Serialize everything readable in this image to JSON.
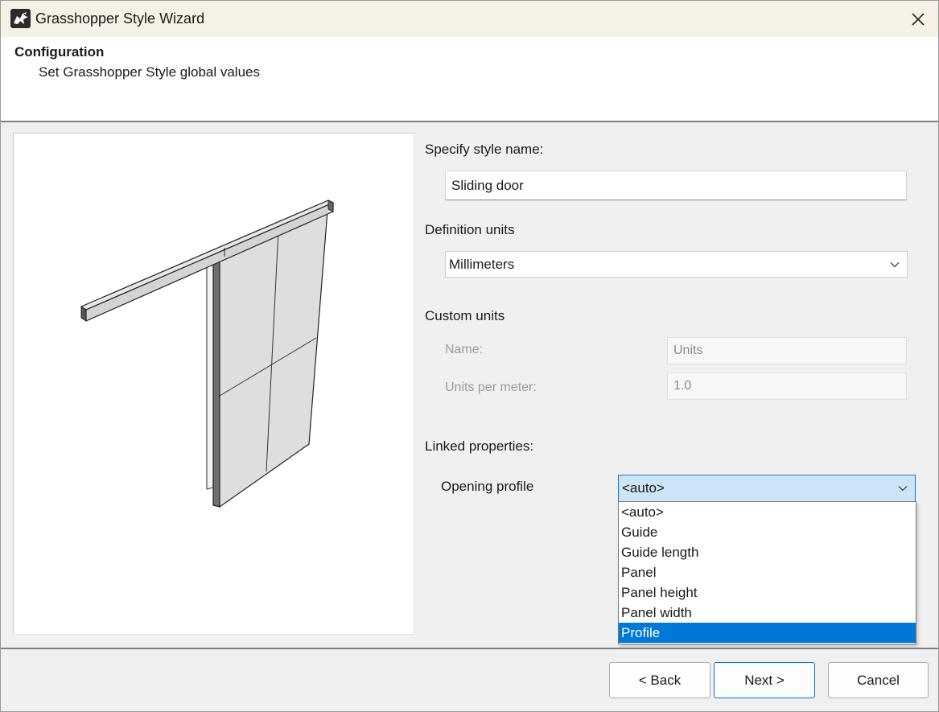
{
  "window": {
    "title": "Grasshopper Style Wizard"
  },
  "header": {
    "title": "Configuration",
    "subtitle": "Set Grasshopper Style global values"
  },
  "form": {
    "style_name_label": "Specify style name:",
    "style_name_value": "Sliding door",
    "definition_units_label": "Definition units",
    "definition_units_value": "Millimeters",
    "custom_units_label": "Custom units",
    "custom_name_label": "Name:",
    "custom_name_value": "Units",
    "units_per_meter_label": "Units per meter:",
    "units_per_meter_value": "1.0",
    "linked_properties_label": "Linked properties:",
    "opening_profile_label": "Opening profile",
    "opening_profile_value": "<auto>"
  },
  "dropdown": {
    "items": [
      "<auto>",
      "Guide",
      "Guide length",
      "Panel",
      "Panel height",
      "Panel width",
      "Profile"
    ],
    "highlighted": "Profile"
  },
  "buttons": {
    "back": "< Back",
    "next": "Next >",
    "cancel": "Cancel"
  },
  "icons": {
    "app": "rhino-icon",
    "close": "close-icon",
    "chevron": "chevron-down-icon"
  },
  "colors": {
    "titlebar": "#f6f1e6",
    "accent": "#0078d7",
    "combo_open": "#cce4f7"
  }
}
